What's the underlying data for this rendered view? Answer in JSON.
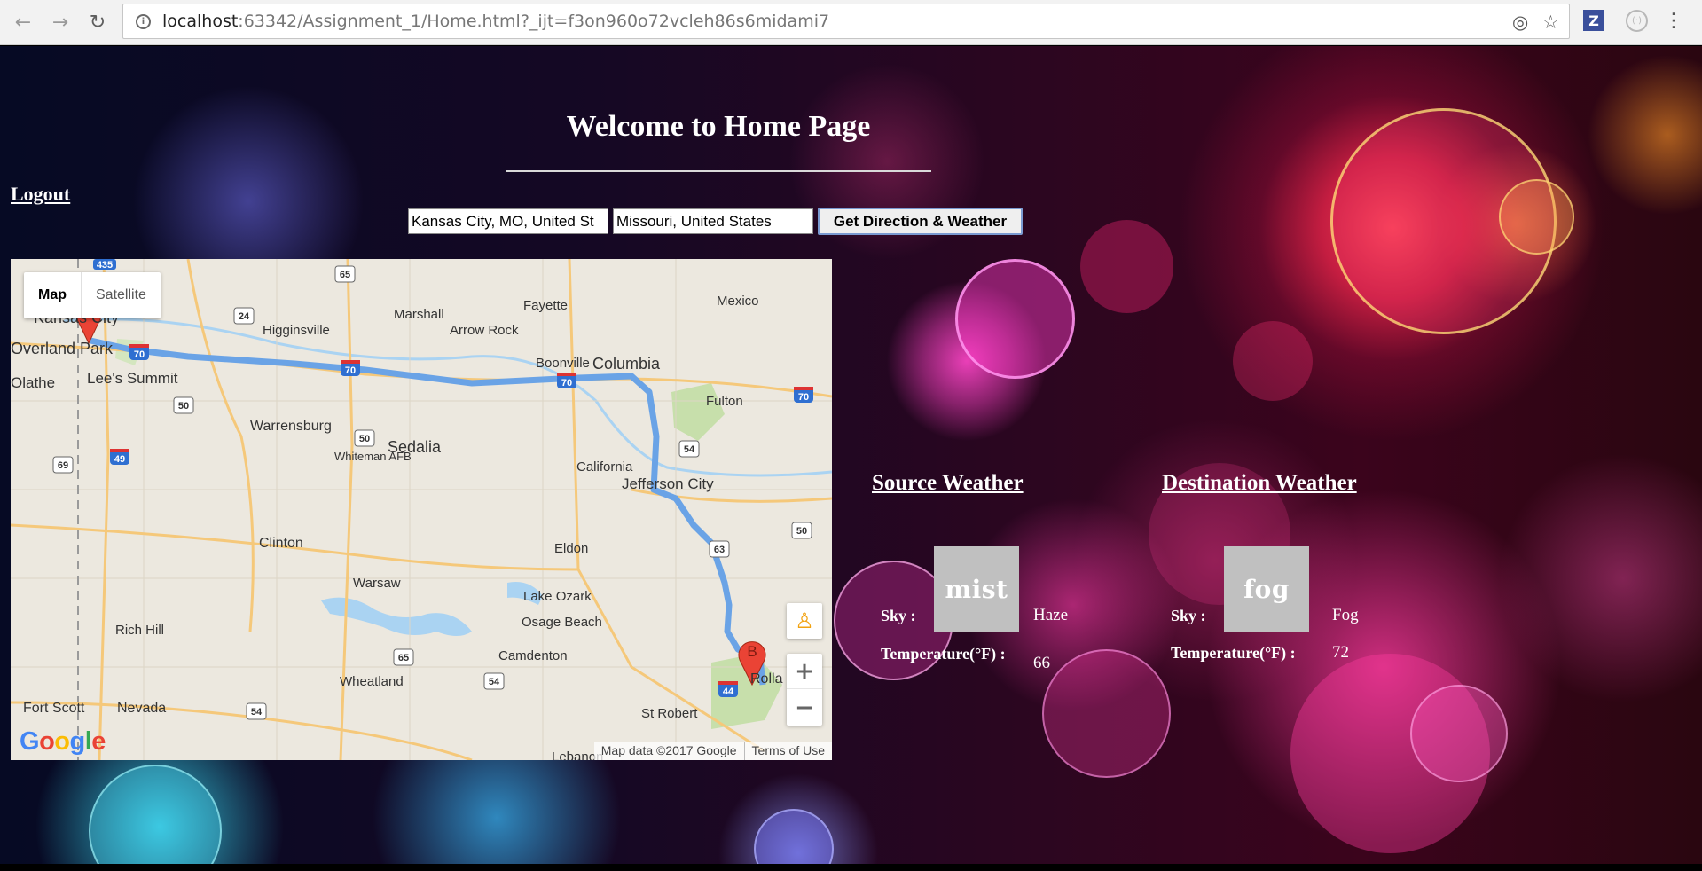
{
  "browser": {
    "url_host": "localhost",
    "url_rest": ":63342/Assignment_1/Home.html?_ijt=f3on960o72vcleh86s6midami7",
    "icons": {
      "back": "back-arrow-icon",
      "forward": "forward-arrow-icon",
      "reload": "reload-icon",
      "info": "info-icon",
      "location": "target-icon",
      "bookmark": "star-icon",
      "extension": "zotero-icon",
      "extension2": "extension-circle-icon"
    },
    "ext_label": "Z"
  },
  "page": {
    "title": "Welcome to Home Page",
    "logout": "Logout",
    "source_value": "Kansas City, MO, United St",
    "destination_value": "Missouri, United States",
    "button_label": "Get Direction & Weather"
  },
  "map": {
    "type_options": [
      "Map",
      "Satellite"
    ],
    "active_type": "Map",
    "marker_a": "A",
    "marker_b": "B",
    "google_logo": "Google",
    "map_data": "Map data ©2017 Google",
    "terms": "Terms of Use",
    "places": [
      {
        "name": "Kansas City"
      },
      {
        "name": "Overland Park"
      },
      {
        "name": "Olathe"
      },
      {
        "name": "Lee's Summit"
      },
      {
        "name": "Higginsville"
      },
      {
        "name": "Marshall"
      },
      {
        "name": "Arrow Rock"
      },
      {
        "name": "Fayette"
      },
      {
        "name": "Mexico"
      },
      {
        "name": "Boonville"
      },
      {
        "name": "Columbia"
      },
      {
        "name": "Fulton"
      },
      {
        "name": "Warrensburg"
      },
      {
        "name": "Sedalia"
      },
      {
        "name": "Whiteman AFB"
      },
      {
        "name": "California"
      },
      {
        "name": "Jefferson City"
      },
      {
        "name": "Clinton"
      },
      {
        "name": "Eldon"
      },
      {
        "name": "Warsaw"
      },
      {
        "name": "Lake Ozark"
      },
      {
        "name": "Osage Beach"
      },
      {
        "name": "Rich Hill"
      },
      {
        "name": "Camdenton"
      },
      {
        "name": "Wheatland"
      },
      {
        "name": "Fort Scott"
      },
      {
        "name": "Nevada"
      },
      {
        "name": "St Robert"
      },
      {
        "name": "Rolla"
      },
      {
        "name": "Lebanon"
      }
    ],
    "shields": [
      "70",
      "70",
      "70",
      "70",
      "65",
      "24",
      "435",
      "50",
      "50",
      "49",
      "69",
      "54",
      "50",
      "63",
      "65",
      "54",
      "54",
      "44"
    ]
  },
  "weather": {
    "source": {
      "heading": "Source Weather",
      "icon_text": "mist",
      "sky_label": "Sky :",
      "sky_value": "Haze",
      "temp_label": "Temperature(°F) :",
      "temp_value": "66"
    },
    "destination": {
      "heading": "Destination Weather",
      "icon_text": "fog",
      "sky_label": "Sky :",
      "sky_value": "Fog",
      "temp_label": "Temperature(°F) :",
      "temp_value": "72"
    }
  },
  "colors": {
    "route": "#6aa3e6",
    "marker": "#ea4335",
    "map_background": "#ece8df"
  }
}
